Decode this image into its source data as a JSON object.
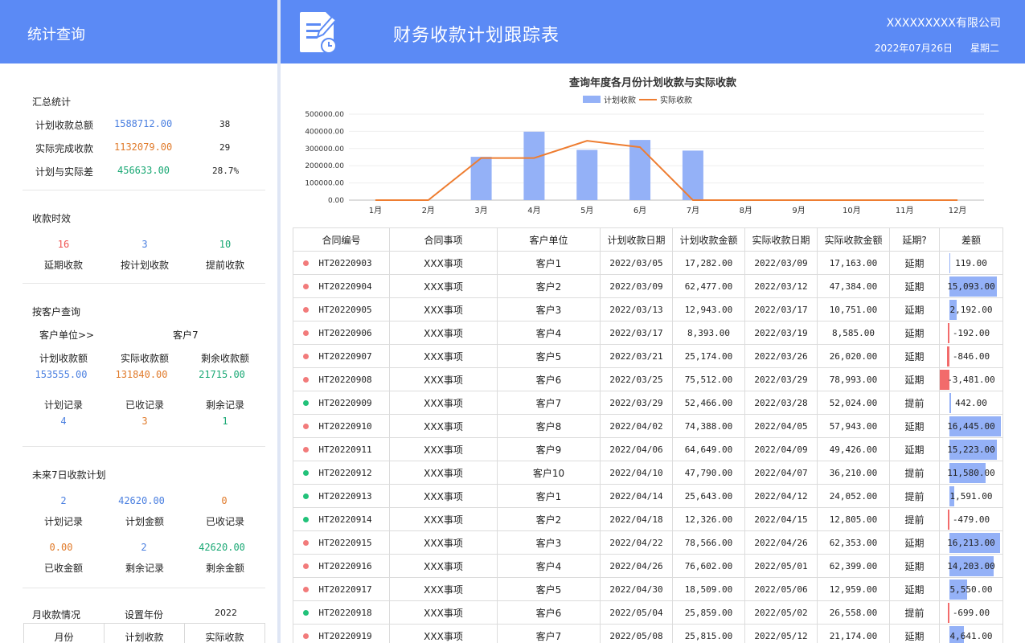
{
  "left": {
    "title": "统计查询",
    "summary": {
      "title": "汇总统计",
      "rows": [
        {
          "label": "计划收款总额",
          "value": "1588712.00",
          "count": "38"
        },
        {
          "label": "实际完成收款",
          "value": "1132079.00",
          "count": "29"
        },
        {
          "label": "计划与实际差",
          "value": "456633.00",
          "count": "28.7%"
        }
      ]
    },
    "timeliness": {
      "title": "收款时效",
      "items": [
        {
          "value": "16",
          "label": "延期收款"
        },
        {
          "value": "3",
          "label": "按计划收款"
        },
        {
          "value": "10",
          "label": "提前收款"
        }
      ]
    },
    "customer": {
      "title": "按客户查询",
      "selector_label": "客户单位>>",
      "selector_value": "客户7",
      "amounts": [
        {
          "label": "计划收款额",
          "value": "153555.00"
        },
        {
          "label": "实际收款额",
          "value": "131840.00"
        },
        {
          "label": "剩余收款额",
          "value": "21715.00"
        }
      ],
      "records": [
        {
          "label": "计划记录",
          "value": "4"
        },
        {
          "label": "已收记录",
          "value": "3"
        },
        {
          "label": "剩余记录",
          "value": "1"
        }
      ]
    },
    "next7": {
      "title": "未来7日收款计划",
      "row1": [
        {
          "value": "2",
          "label": "计划记录"
        },
        {
          "value": "42620.00",
          "label": "计划金额"
        },
        {
          "value": "0",
          "label": "已收记录"
        }
      ],
      "row2": [
        {
          "value": "0.00",
          "label": "已收金额"
        },
        {
          "value": "2",
          "label": "剩余记录"
        },
        {
          "value": "42620.00",
          "label": "剩余金额"
        }
      ]
    },
    "monthly": {
      "title": "月收款情况",
      "set_year_label": "设置年份",
      "year": "2022",
      "headers": [
        "月份",
        "计划收款",
        "实际收款"
      ]
    }
  },
  "header": {
    "title": "财务收款计划跟踪表",
    "company": "XXXXXXXXX有限公司",
    "date": "2022年07月26日",
    "weekday": "星期二"
  },
  "chart_data": {
    "type": "bar",
    "title": "查询年度各月份计划收款与实际收款",
    "categories": [
      "1月",
      "2月",
      "3月",
      "4月",
      "5月",
      "6月",
      "7月",
      "8月",
      "9月",
      "10月",
      "11月",
      "12月"
    ],
    "series": [
      {
        "name": "计划收款",
        "type": "bar",
        "values": [
          0,
          0,
          252000,
          398000,
          292000,
          350000,
          288000,
          0,
          0,
          0,
          0,
          0
        ]
      },
      {
        "name": "实际收款",
        "type": "line",
        "values": [
          0,
          0,
          245000,
          245000,
          345000,
          308000,
          0,
          0,
          0,
          0,
          0,
          0
        ]
      }
    ],
    "yticks": [
      "0.00",
      "100000.00",
      "200000.00",
      "300000.00",
      "400000.00",
      "500000.00"
    ],
    "ylim": [
      0,
      500000
    ],
    "grid": true,
    "legend_position": "top-center",
    "colors": {
      "bar": "#94b1f7",
      "line": "#ee7d31"
    }
  },
  "table": {
    "headers": [
      "合同编号",
      "合同事项",
      "客户单位",
      "计划收款日期",
      "计划收款金额",
      "实际收款日期",
      "实际收款金额",
      "延期?",
      "差额"
    ],
    "status_colors": {
      "延期": "#f27b7b",
      "提前": "#22c27a"
    },
    "bar_colors": {
      "positive": "#94b1f7",
      "negative": "#f26b6b"
    },
    "rows": [
      {
        "id": "HT20220903",
        "item": "XXX事项",
        "client": "客户1",
        "plan_date": "2022/03/05",
        "plan_amt": "17,282.00",
        "act_date": "2022/03/09",
        "act_amt": "17,163.00",
        "status": "延期",
        "diff": "119.00",
        "diff_value": 119
      },
      {
        "id": "HT20220904",
        "item": "XXX事项",
        "client": "客户2",
        "plan_date": "2022/03/09",
        "plan_amt": "62,477.00",
        "act_date": "2022/03/12",
        "act_amt": "47,384.00",
        "status": "延期",
        "diff": "15,093.00",
        "diff_value": 15093
      },
      {
        "id": "HT20220905",
        "item": "XXX事项",
        "client": "客户3",
        "plan_date": "2022/03/13",
        "plan_amt": "12,943.00",
        "act_date": "2022/03/17",
        "act_amt": "10,751.00",
        "status": "延期",
        "diff": "2,192.00",
        "diff_value": 2192
      },
      {
        "id": "HT20220906",
        "item": "XXX事项",
        "client": "客户4",
        "plan_date": "2022/03/17",
        "plan_amt": "8,393.00",
        "act_date": "2022/03/19",
        "act_amt": "8,585.00",
        "status": "延期",
        "diff": "-192.00",
        "diff_value": -192
      },
      {
        "id": "HT20220907",
        "item": "XXX事项",
        "client": "客户5",
        "plan_date": "2022/03/21",
        "plan_amt": "25,174.00",
        "act_date": "2022/03/26",
        "act_amt": "26,020.00",
        "status": "延期",
        "diff": "-846.00",
        "diff_value": -846
      },
      {
        "id": "HT20220908",
        "item": "XXX事项",
        "client": "客户6",
        "plan_date": "2022/03/25",
        "plan_amt": "75,512.00",
        "act_date": "2022/03/29",
        "act_amt": "78,993.00",
        "status": "延期",
        "diff": "-3,481.00",
        "diff_value": -3481
      },
      {
        "id": "HT20220909",
        "item": "XXX事项",
        "client": "客户7",
        "plan_date": "2022/03/29",
        "plan_amt": "52,466.00",
        "act_date": "2022/03/28",
        "act_amt": "52,024.00",
        "status": "提前",
        "diff": "442.00",
        "diff_value": 442
      },
      {
        "id": "HT20220910",
        "item": "XXX事项",
        "client": "客户8",
        "plan_date": "2022/04/02",
        "plan_amt": "74,388.00",
        "act_date": "2022/04/05",
        "act_amt": "57,943.00",
        "status": "延期",
        "diff": "16,445.00",
        "diff_value": 16445
      },
      {
        "id": "HT20220911",
        "item": "XXX事项",
        "client": "客户9",
        "plan_date": "2022/04/06",
        "plan_amt": "64,649.00",
        "act_date": "2022/04/09",
        "act_amt": "49,426.00",
        "status": "延期",
        "diff": "15,223.00",
        "diff_value": 15223
      },
      {
        "id": "HT20220912",
        "item": "XXX事项",
        "client": "客户10",
        "plan_date": "2022/04/10",
        "plan_amt": "47,790.00",
        "act_date": "2022/04/07",
        "act_amt": "36,210.00",
        "status": "提前",
        "diff": "11,580.00",
        "diff_value": 11580
      },
      {
        "id": "HT20220913",
        "item": "XXX事项",
        "client": "客户1",
        "plan_date": "2022/04/14",
        "plan_amt": "25,643.00",
        "act_date": "2022/04/12",
        "act_amt": "24,052.00",
        "status": "提前",
        "diff": "1,591.00",
        "diff_value": 1591
      },
      {
        "id": "HT20220914",
        "item": "XXX事项",
        "client": "客户2",
        "plan_date": "2022/04/18",
        "plan_amt": "12,326.00",
        "act_date": "2022/04/15",
        "act_amt": "12,805.00",
        "status": "提前",
        "diff": "-479.00",
        "diff_value": -479
      },
      {
        "id": "HT20220915",
        "item": "XXX事项",
        "client": "客户3",
        "plan_date": "2022/04/22",
        "plan_amt": "78,566.00",
        "act_date": "2022/04/26",
        "act_amt": "62,353.00",
        "status": "延期",
        "diff": "16,213.00",
        "diff_value": 16213
      },
      {
        "id": "HT20220916",
        "item": "XXX事项",
        "client": "客户4",
        "plan_date": "2022/04/26",
        "plan_amt": "76,602.00",
        "act_date": "2022/05/01",
        "act_amt": "62,399.00",
        "status": "延期",
        "diff": "14,203.00",
        "diff_value": 14203
      },
      {
        "id": "HT20220917",
        "item": "XXX事项",
        "client": "客户5",
        "plan_date": "2022/04/30",
        "plan_amt": "18,509.00",
        "act_date": "2022/05/06",
        "act_amt": "12,959.00",
        "status": "延期",
        "diff": "5,550.00",
        "diff_value": 5550
      },
      {
        "id": "HT20220918",
        "item": "XXX事项",
        "client": "客户6",
        "plan_date": "2022/05/04",
        "plan_amt": "25,859.00",
        "act_date": "2022/05/02",
        "act_amt": "26,558.00",
        "status": "提前",
        "diff": "-699.00",
        "diff_value": -699
      },
      {
        "id": "HT20220919",
        "item": "XXX事项",
        "client": "客户7",
        "plan_date": "2022/05/08",
        "plan_amt": "25,815.00",
        "act_date": "2022/05/12",
        "act_amt": "21,174.00",
        "status": "延期",
        "diff": "4,641.00",
        "diff_value": 4641
      }
    ]
  }
}
